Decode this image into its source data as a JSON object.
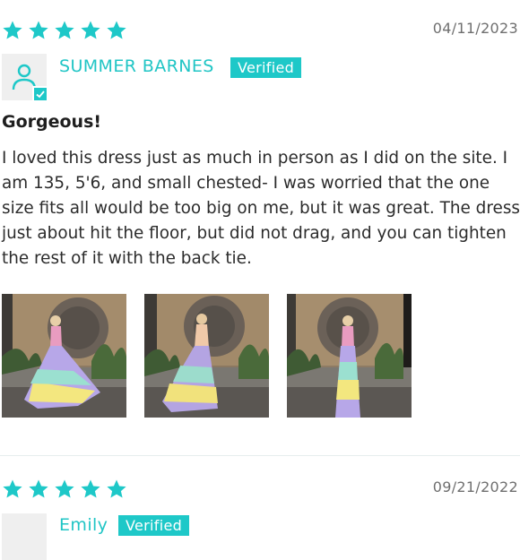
{
  "reviews": [
    {
      "rating": 5,
      "date": "04/11/2023",
      "author": "SUMMER BARNES",
      "badge": "Verified",
      "title": "Gorgeous!",
      "body": "I loved this dress just as much in person as I did on the site. I am 135, 5'6, and small chested- I was worried that the one size fits all would be too big on me, but it was great. The dress just about hit the floor, but did not drag, and you can tighten the rest of it with the back tie.",
      "photos": [
        "review-photo",
        "review-photo",
        "review-photo"
      ]
    },
    {
      "rating": 5,
      "date": "09/21/2022",
      "author": "Emily",
      "badge": "Verified"
    }
  ],
  "colors": {
    "accent": "#1ec8c8",
    "star": "#1ec8c8",
    "date": "#6f6f6f"
  },
  "icons": [
    "star-icon",
    "user-icon",
    "checkmark-icon"
  ]
}
